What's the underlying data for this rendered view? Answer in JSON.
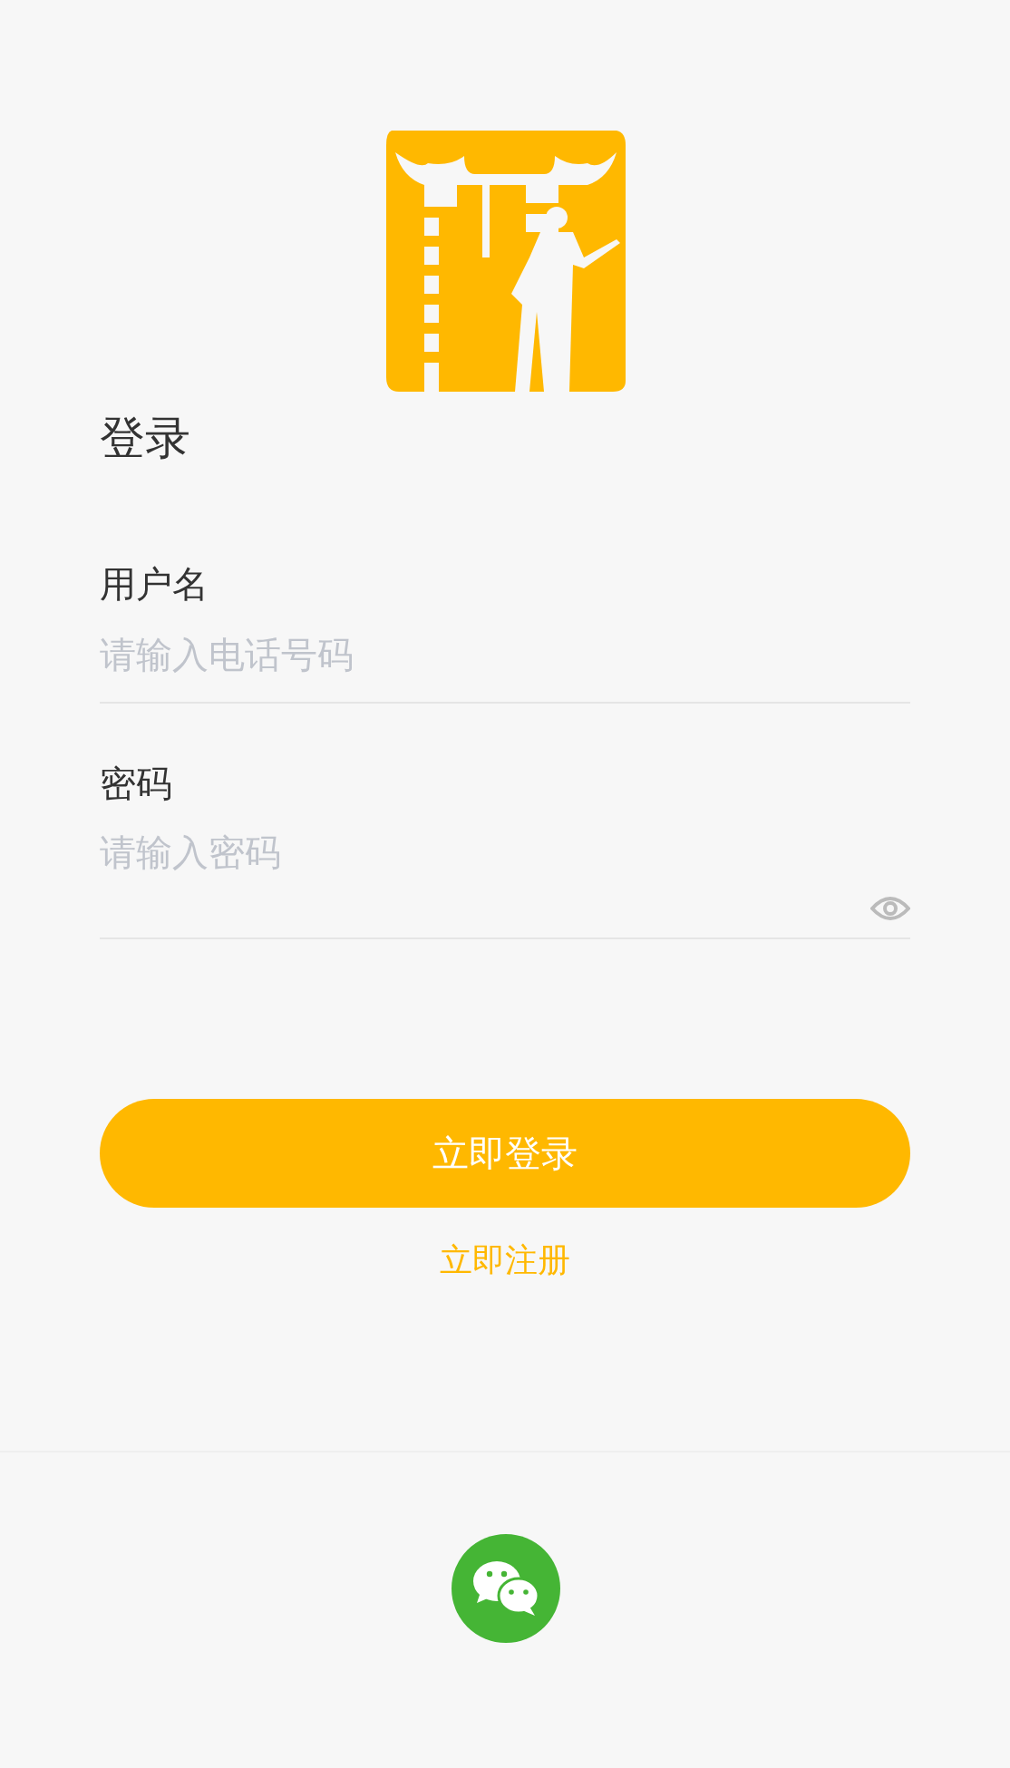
{
  "title": "登录",
  "fields": [
    {
      "label": "用户名",
      "placeholder": "请输入电话号码",
      "kind": "text"
    },
    {
      "label": "密码",
      "placeholder": "请输入密码",
      "kind": "password"
    }
  ],
  "login_button": "立即登录",
  "register_link": "立即注册"
}
